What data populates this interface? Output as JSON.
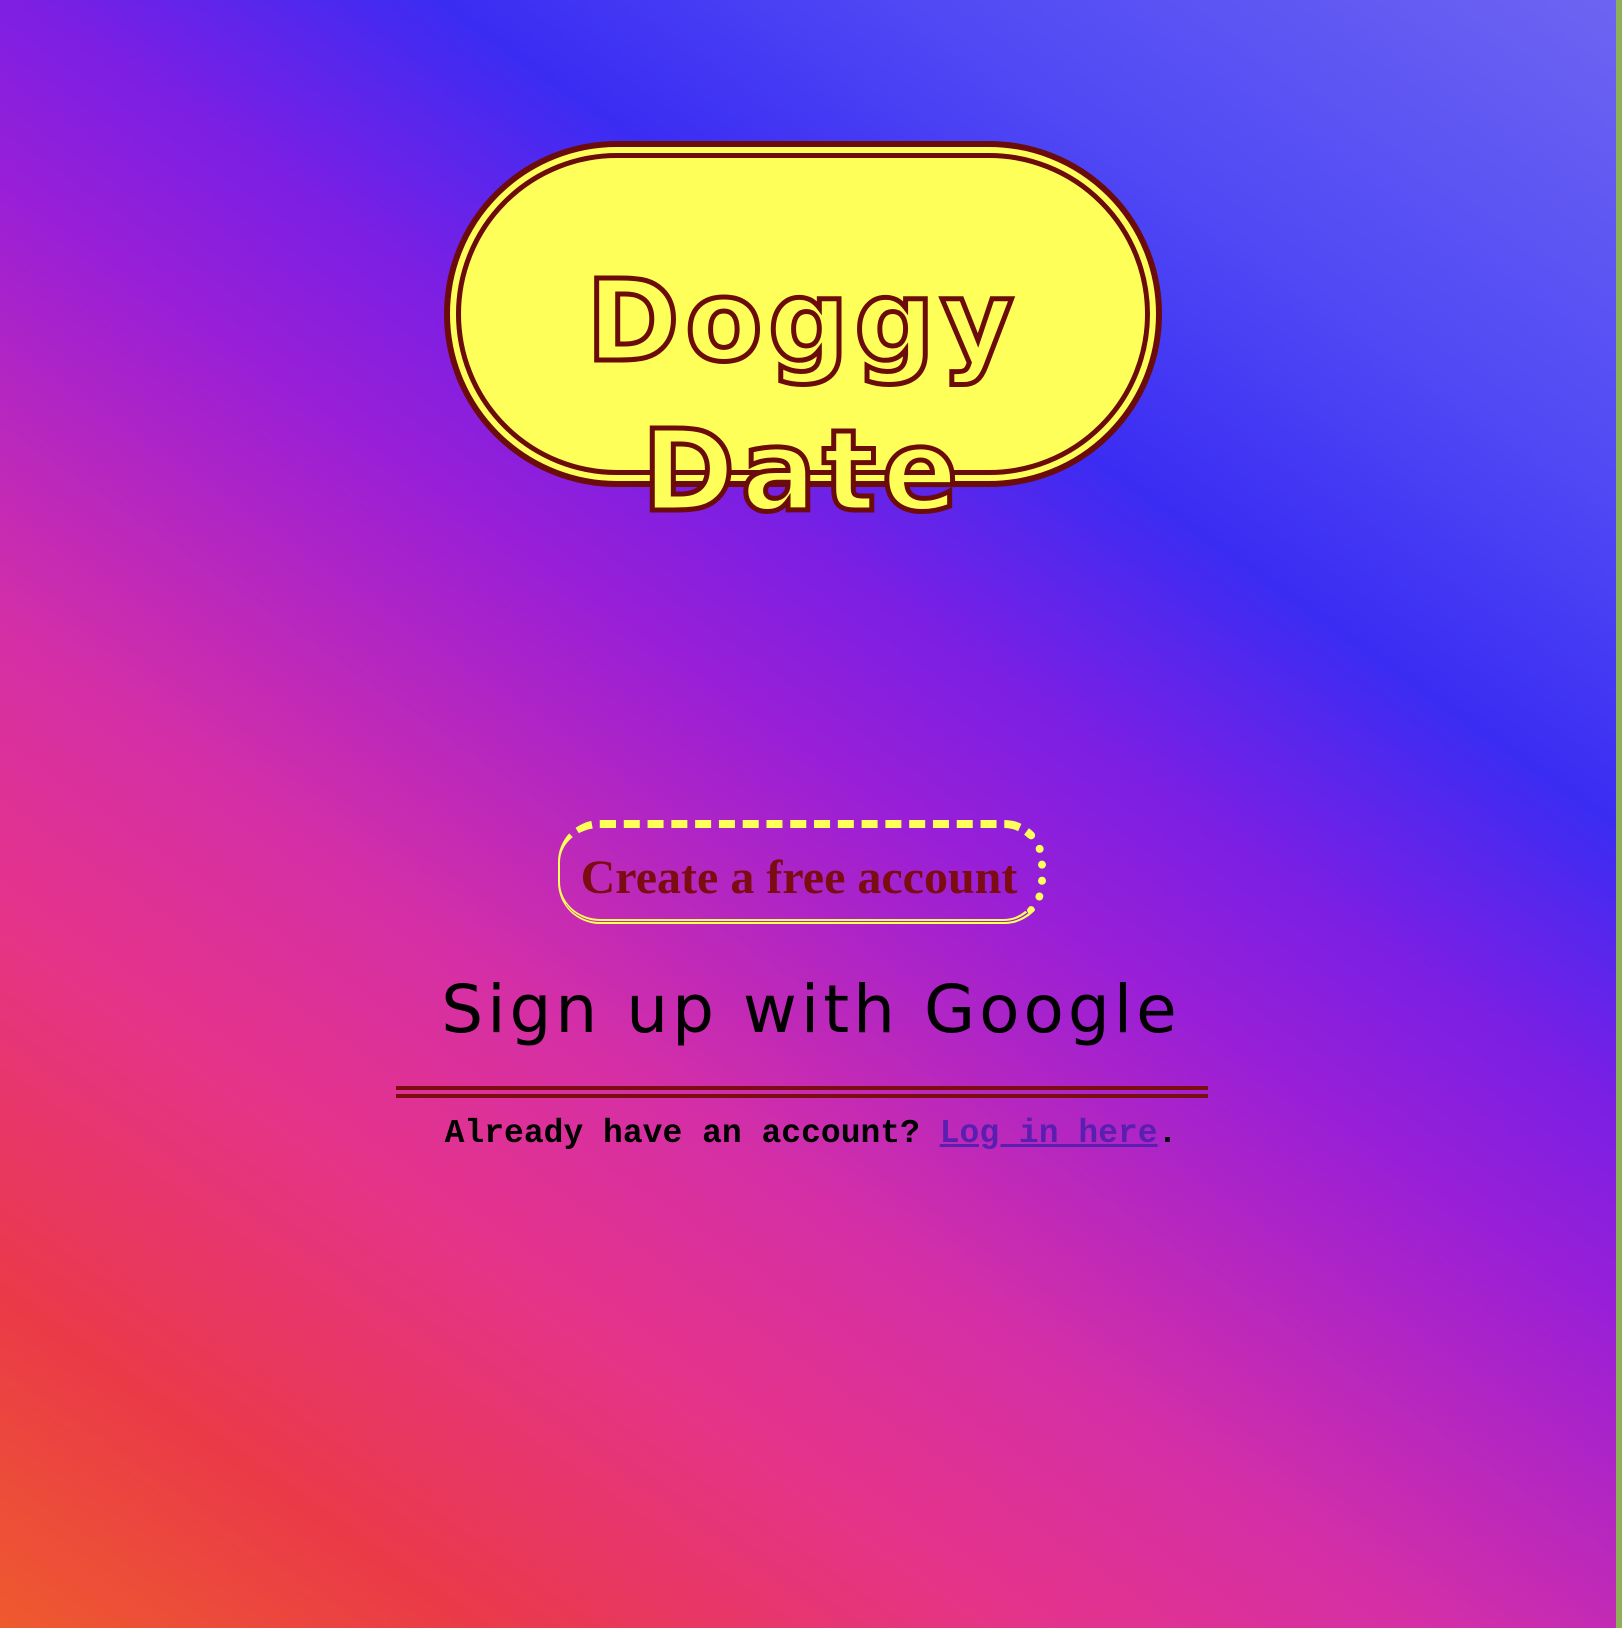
{
  "logo": {
    "title": "Doggy Date"
  },
  "actions": {
    "create_account_label": "Create a free account",
    "google_signup_label": "Sign up with Google"
  },
  "login": {
    "prompt": "Already have an account?",
    "link_text": "Log in here",
    "suffix": "."
  },
  "colors": {
    "logo_fill": "#ffff59",
    "logo_outline": "#6b0b0b",
    "button_text": "#7a0c12",
    "link": "#5a1fb0"
  }
}
